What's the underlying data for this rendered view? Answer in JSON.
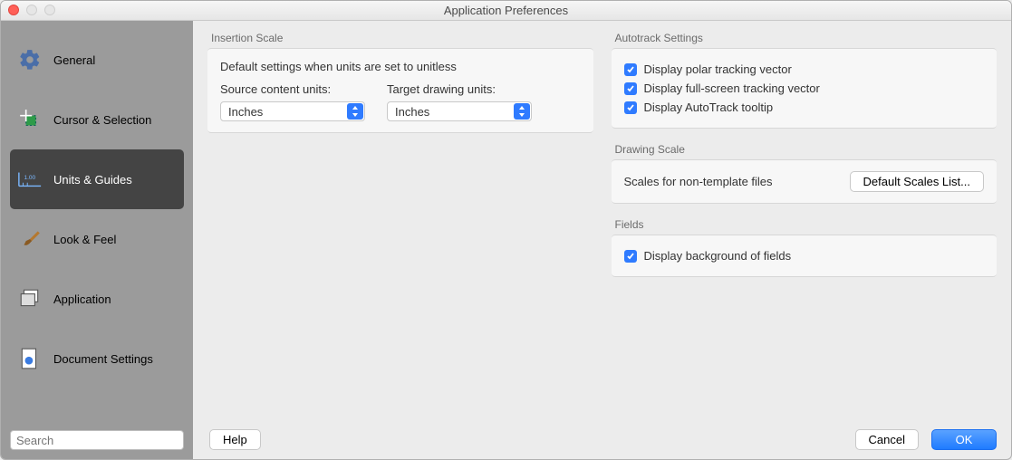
{
  "window": {
    "title": "Application Preferences"
  },
  "sidebar": {
    "items": [
      {
        "label": "General"
      },
      {
        "label": "Cursor & Selection"
      },
      {
        "label": "Units & Guides"
      },
      {
        "label": "Look & Feel"
      },
      {
        "label": "Application"
      },
      {
        "label": "Document Settings"
      }
    ],
    "search_placeholder": "Search"
  },
  "insertion": {
    "title": "Insertion Scale",
    "desc": "Default settings when units are set to unitless",
    "source_label": "Source content units:",
    "source_value": "Inches",
    "target_label": "Target drawing units:",
    "target_value": "Inches"
  },
  "autotrack": {
    "title": "Autotrack Settings",
    "items": [
      "Display polar tracking vector",
      "Display full-screen tracking vector",
      "Display AutoTrack tooltip"
    ]
  },
  "drawing": {
    "title": "Drawing Scale",
    "label": "Scales for non-template files",
    "button": "Default Scales List..."
  },
  "fields": {
    "title": "Fields",
    "label": "Display background of fields"
  },
  "footer": {
    "help": "Help",
    "cancel": "Cancel",
    "ok": "OK"
  }
}
